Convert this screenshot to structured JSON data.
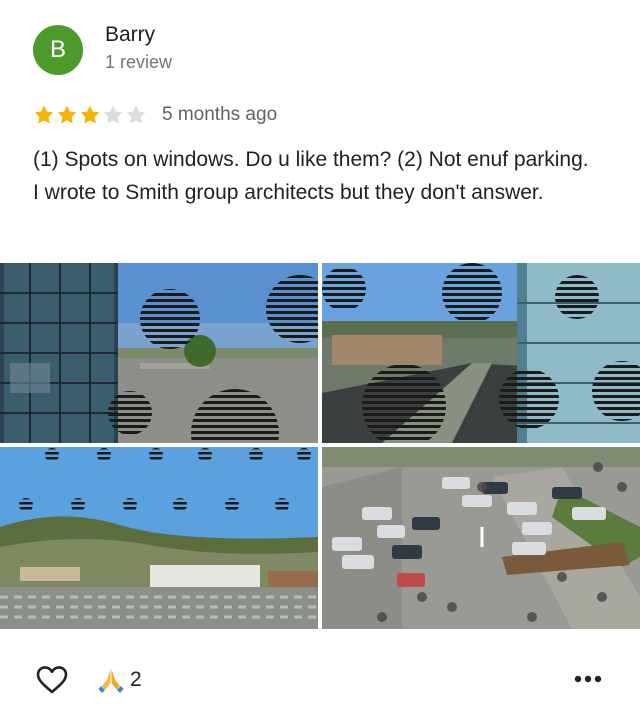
{
  "reviewer": {
    "initial": "B",
    "name": "Barry",
    "review_count": "1 review",
    "avatar_color": "#4d9a2c"
  },
  "rating": {
    "value": 3,
    "max": 5,
    "filled_color": "#f4b400",
    "empty_color": "#dadce0"
  },
  "review": {
    "time_ago": "5 months ago",
    "text": "(1) Spots on windows. Do u like them? (2) Not enuf parking. I wrote to Smith group architects but they don't answer."
  },
  "photos": [
    {
      "icon": "building-facade-photo"
    },
    {
      "icon": "street-view-photo"
    },
    {
      "icon": "hillside-view-photo"
    },
    {
      "icon": "parking-lot-photo"
    }
  ],
  "actions": {
    "like_icon": "heart-outline-icon",
    "reaction_icon": "folded-hands-icon",
    "reaction_count": "2",
    "more_icon": "more-horizontal-icon"
  }
}
